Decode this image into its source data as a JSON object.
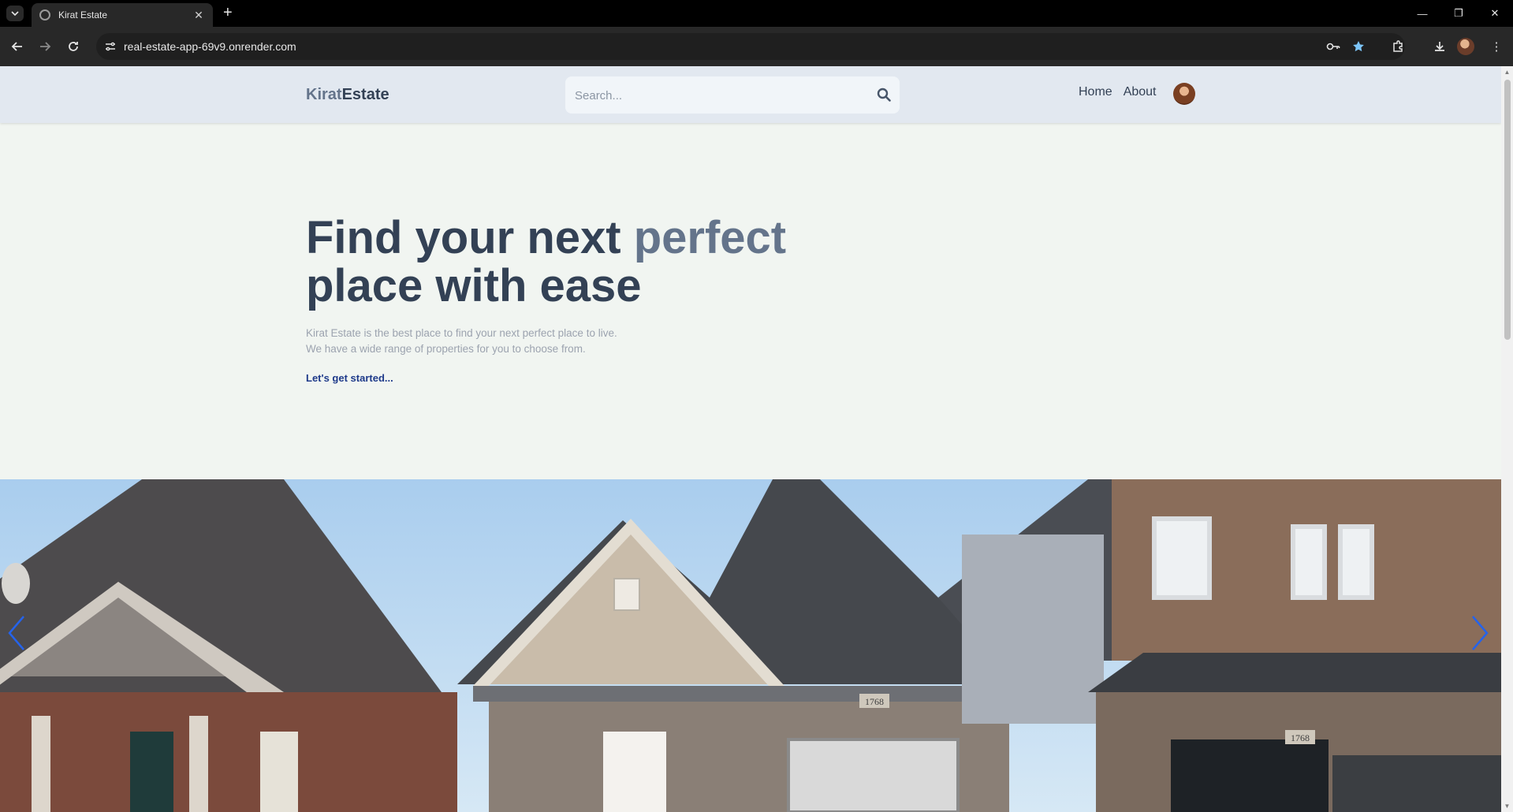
{
  "browser": {
    "tab_title": "Kirat Estate",
    "url": "real-estate-app-69v9.onrender.com"
  },
  "header": {
    "logo_part1": "Kirat",
    "logo_part2": "Estate",
    "search_placeholder": "Search...",
    "nav": [
      "Home",
      "About"
    ]
  },
  "hero": {
    "title_part1": "Find your next ",
    "title_accent": "perfect",
    "title_part2": "place with ease",
    "description_line1": "Kirat Estate is the best place to find your next perfect place to live.",
    "description_line2": "We have a wide range of properties for you to choose from.",
    "cta": "Let's get started..."
  },
  "slider": {
    "house_numbers": [
      "1768",
      "1768"
    ]
  },
  "colors": {
    "header_bg": "#e2e8f0",
    "page_bg": "#f1f5f1",
    "heading": "#334155",
    "accent": "#64748b",
    "link": "#1e3a8a",
    "slider_arrow": "#2563eb"
  }
}
